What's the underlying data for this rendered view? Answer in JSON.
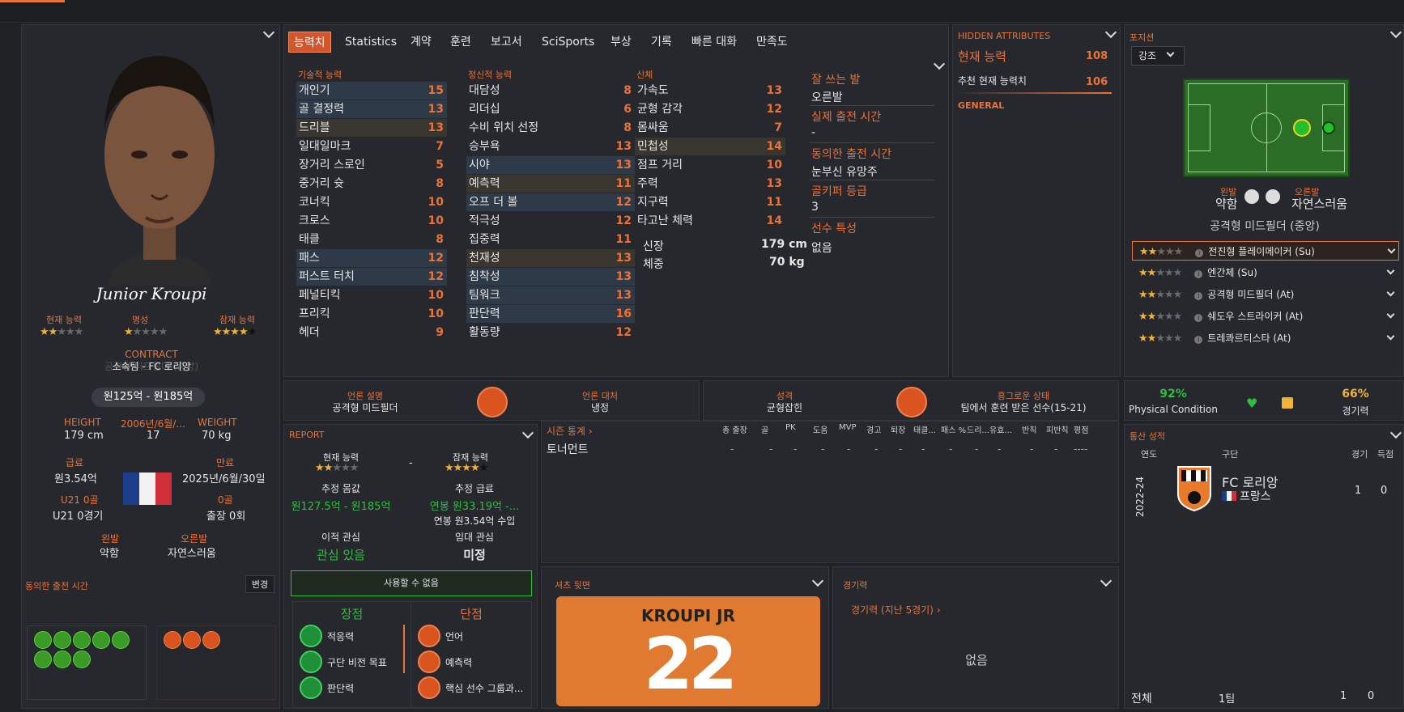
{
  "colors": {
    "accent": "#e8743b",
    "bg": "#202226",
    "panel": "#26282d",
    "green": "#2fbf3f"
  },
  "profile": {
    "name": "Junior Kroupi",
    "ca_label": "현재 능력",
    "rep_label": "명성",
    "pa_label": "잠재 능력",
    "ca_stars": 2,
    "rep_stars": 1,
    "pa_stars": 4,
    "contract_label": "CONTRACT",
    "contract_text": "소속팀 - FC 로리앙",
    "role_ghost": "공격형 미드필더 (중앙)",
    "value_range": "원125억 - 원185억",
    "height_label": "HEIGHT",
    "height": "179 cm",
    "dob_label": "2006년/6월/...",
    "age": "17",
    "weight_label": "WEIGHT",
    "weight": "70 kg",
    "wage_label": "급료",
    "wage": "원3.54억",
    "expiry_label": "만료",
    "expiry": "2025년/6월/30일",
    "u21_label": "U21 0골",
    "u21_val": "U21 0경기",
    "goals_label": "0골",
    "apps_val": "출장 0회",
    "leftfoot_label": "왼발",
    "leftfoot": "약함",
    "rightfoot_label": "오른발",
    "rightfoot": "자연스러움",
    "agreed_label": "동의한 출전 시간",
    "change_btn": "변경"
  },
  "tabs": [
    "능력치",
    "Statistics",
    "계약",
    "훈련",
    "보고서",
    "SciSports",
    "부상",
    "기록",
    "빠른 대화",
    "만족도"
  ],
  "technical": {
    "title": "기술적 능력",
    "items": [
      {
        "n": "개인기",
        "v": "15"
      },
      {
        "n": "골 결정력",
        "v": "13"
      },
      {
        "n": "드리블",
        "v": "13"
      },
      {
        "n": "일대일마크",
        "v": "7"
      },
      {
        "n": "장거리 스로인",
        "v": "5"
      },
      {
        "n": "중거리 슛",
        "v": "8"
      },
      {
        "n": "코너킥",
        "v": "10"
      },
      {
        "n": "크로스",
        "v": "10"
      },
      {
        "n": "태클",
        "v": "8"
      },
      {
        "n": "패스",
        "v": "12"
      },
      {
        "n": "퍼스트 터치",
        "v": "12"
      },
      {
        "n": "페널티킥",
        "v": "10"
      },
      {
        "n": "프리킥",
        "v": "10"
      },
      {
        "n": "헤더",
        "v": "9"
      }
    ]
  },
  "mental": {
    "title": "정신적 능력",
    "items": [
      {
        "n": "대담성",
        "v": "8"
      },
      {
        "n": "리더십",
        "v": "6"
      },
      {
        "n": "수비 위치 선정",
        "v": "8"
      },
      {
        "n": "승부욕",
        "v": "13"
      },
      {
        "n": "시야",
        "v": "13"
      },
      {
        "n": "예측력",
        "v": "11"
      },
      {
        "n": "오프 더 볼",
        "v": "12"
      },
      {
        "n": "적극성",
        "v": "12"
      },
      {
        "n": "집중력",
        "v": "11"
      },
      {
        "n": "천재성",
        "v": "13"
      },
      {
        "n": "침착성",
        "v": "13"
      },
      {
        "n": "팀워크",
        "v": "13"
      },
      {
        "n": "판단력",
        "v": "16"
      },
      {
        "n": "활동량",
        "v": "12"
      }
    ]
  },
  "physical": {
    "title": "신체",
    "items": [
      {
        "n": "가속도",
        "v": "13"
      },
      {
        "n": "균형 감각",
        "v": "12"
      },
      {
        "n": "몸싸움",
        "v": "7"
      },
      {
        "n": "민첩성",
        "v": "14"
      },
      {
        "n": "점프 거리",
        "v": "10"
      },
      {
        "n": "주력",
        "v": "13"
      },
      {
        "n": "지구력",
        "v": "11"
      },
      {
        "n": "타고난 체력",
        "v": "14"
      }
    ],
    "height_label": "신장",
    "height": "179 cm",
    "weight_label": "체중",
    "weight": "70 kg"
  },
  "side_info": {
    "foot_label": "잘 쓰는 발",
    "foot": "오른발",
    "actual_label": "실제 출전 시간",
    "actual": "-",
    "agreed_label": "동의한 출전 시간",
    "agreed": "눈부신 유망주",
    "gk_label": "골키퍼 등급",
    "gk": "3",
    "traits_label": "선수 특성",
    "traits": "없음"
  },
  "hidden": {
    "title": "HIDDEN ATTRIBUTES",
    "ca_label": "현재 능력",
    "ca": "108",
    "rec_label": "추천 현재 능력치",
    "rec": "106",
    "general": "GENERAL"
  },
  "position": {
    "title": "포지션",
    "dropdown": "강조",
    "left_label": "왼발",
    "left": "약함",
    "right_label": "오른발",
    "right": "자연스러움",
    "role": "공격형 미드필더 (중앙)",
    "roles": [
      {
        "stars": 2,
        "name": "전진형 플레이메이커 (Su)"
      },
      {
        "stars": 2,
        "name": "엔간체 (Su)"
      },
      {
        "stars": 2,
        "name": "공격형 미드필더 (At)"
      },
      {
        "stars": 2,
        "name": "쉐도우 스트라이커 (At)"
      },
      {
        "stars": 2,
        "name": "트레콰르티스타 (At)"
      }
    ]
  },
  "mid_row": {
    "a_label": "언론 설명",
    "a_val": "공격형 미드필더",
    "b_label": "언론 대처",
    "b_val": "냉정",
    "c_label": "성격",
    "c_val": "균형잡힌",
    "d_label": "흥그로운 상태",
    "d_val": "팀에서 훈련 받은 선수(15-21)",
    "physical_pct": "92%",
    "physical_label": "Physical Condition",
    "match_pct": "66%",
    "match_label": "경기력"
  },
  "report": {
    "title": "REPORT",
    "ca_label": "현재 능력",
    "pa_label": "잠재 능력",
    "ca_stars": 2,
    "pa_stars": 4,
    "dash": "-",
    "value_label": "추정 몸값",
    "value": "원127.5억 - 원185억",
    "wage_label": "추정 급료",
    "wage": "연봉 원33.19억 -...",
    "wage_note": "연봉 원3.54억 수입",
    "transfer_label": "이적 관심",
    "transfer": "관심 있음",
    "loan_label": "임대 관심",
    "loan": "미정",
    "unusable": "사용할 수 없음",
    "pros_label": "장점",
    "pros": [
      "적응력",
      "구단 비전 목표",
      "판단력"
    ],
    "cons_label": "단점",
    "cons": [
      "언어",
      "예측력",
      "핵심 선수 그룹과..."
    ]
  },
  "season": {
    "title": "시즌 통계 ›",
    "cols": [
      "총 출장",
      "골",
      "PK",
      "도움",
      "MVP",
      "경고",
      "퇴장",
      "태클...",
      "패스 %",
      "드리...",
      "유효...",
      "반칙",
      "피반칙",
      "평점"
    ],
    "row": "토너먼트",
    "dashes": [
      "-",
      "-",
      "-",
      "-",
      "-",
      "-",
      "-",
      "-",
      "-",
      "-",
      "-",
      "-",
      "-",
      "----"
    ]
  },
  "shirt": {
    "title": "셔츠 뒷면",
    "name": "KROUPI JR",
    "number": "22"
  },
  "form": {
    "title": "경기력",
    "link": "경기력 (지난 5경기) ›",
    "empty": "없음"
  },
  "career": {
    "title": "통산 성적",
    "h_year": "연도",
    "h_club": "구단",
    "h_apps": "경기",
    "h_goals": "득점",
    "year": "2022-24",
    "club": "FC 로리앙",
    "nation": "프랑스",
    "apps": "1",
    "goals": "0",
    "total_label": "전체",
    "total_team": "1팀",
    "total_apps": "1",
    "total_goals": "0"
  }
}
